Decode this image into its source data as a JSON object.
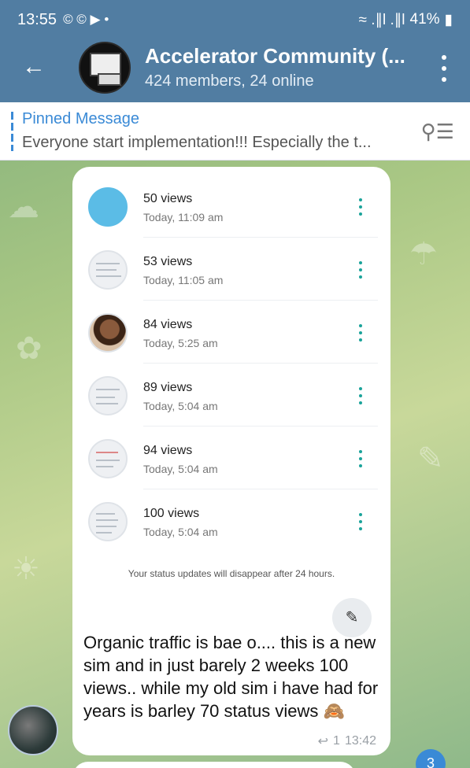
{
  "statusbar": {
    "time": "13:55",
    "battery": "41%",
    "notif_icons": "© © ▶ •",
    "signal": "≈ .∥l .∥l"
  },
  "header": {
    "title": "Accelerator Community (...",
    "subtitle": "424 members, 24 online"
  },
  "pinned": {
    "title": "Pinned Message",
    "text": "Everyone start implementation!!!  Especially the t..."
  },
  "status_list": [
    {
      "views": "50 views",
      "time": "Today, 11:09 am"
    },
    {
      "views": "53 views",
      "time": "Today, 11:05 am"
    },
    {
      "views": "84 views",
      "time": "Today, 5:25 am"
    },
    {
      "views": "89 views",
      "time": "Today, 5:04 am"
    },
    {
      "views": "94 views",
      "time": "Today, 5:04 am"
    },
    {
      "views": "100 views",
      "time": "Today, 5:04 am"
    }
  ],
  "status_note": "Your status updates will disappear after 24 hours.",
  "message": {
    "text": "Organic traffic is bae o.... this is a new sim and in just barely 2 weeks 100 views.. while my old sim i have had for years is barley 70 status  views 🙈",
    "replies": "1",
    "time": "13:42"
  },
  "unread_badge": "3",
  "colors": {
    "header": "#517da2",
    "accent": "#3a8ad6",
    "teal": "#1aa39a"
  }
}
